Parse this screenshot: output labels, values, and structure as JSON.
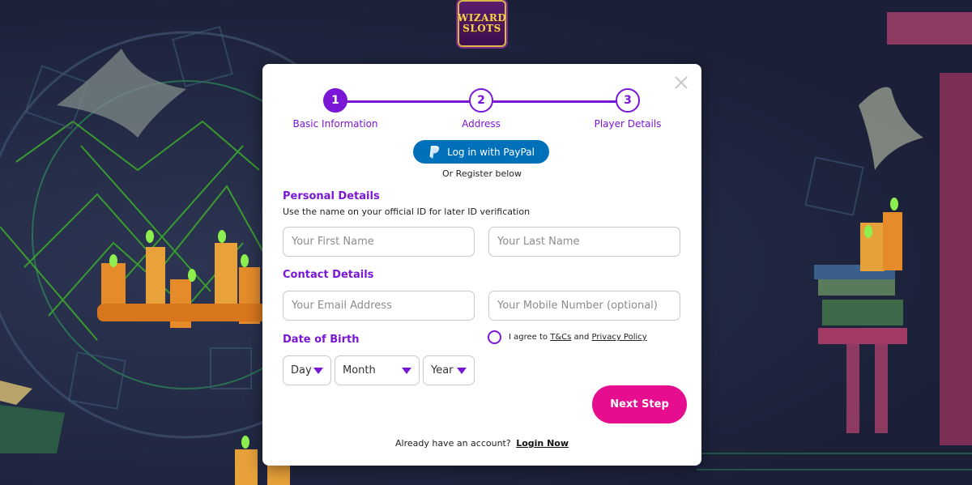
{
  "logo": {
    "line1": "WIZARD",
    "line2": "SLOTS"
  },
  "stepper": {
    "steps": [
      {
        "number": "1",
        "label": "Basic Information"
      },
      {
        "number": "2",
        "label": "Address"
      },
      {
        "number": "3",
        "label": "Player Details"
      }
    ]
  },
  "paypal": {
    "label": "Log in with PayPal"
  },
  "or_register": "Or Register below",
  "personal": {
    "title": "Personal Details",
    "subtitle": "Use the name on your official ID for later ID verification",
    "first_name_placeholder": "Your First Name",
    "last_name_placeholder": "Your Last Name"
  },
  "contact": {
    "title": "Contact Details",
    "email_placeholder": "Your Email Address",
    "mobile_placeholder": "Your Mobile Number (optional)"
  },
  "dob": {
    "title": "Date of Birth",
    "day": "Day",
    "month": "Month",
    "year": "Year"
  },
  "agree": {
    "prefix": "I agree to",
    "tcs": "T&Cs",
    "and": "and",
    "privacy": "Privacy Policy"
  },
  "next_button": "Next Step",
  "footer": {
    "text": "Already have an account?",
    "login": "Login Now"
  },
  "colors": {
    "accent": "#7a16d6",
    "cta": "#e60d8e",
    "paypal": "#0070ba"
  }
}
